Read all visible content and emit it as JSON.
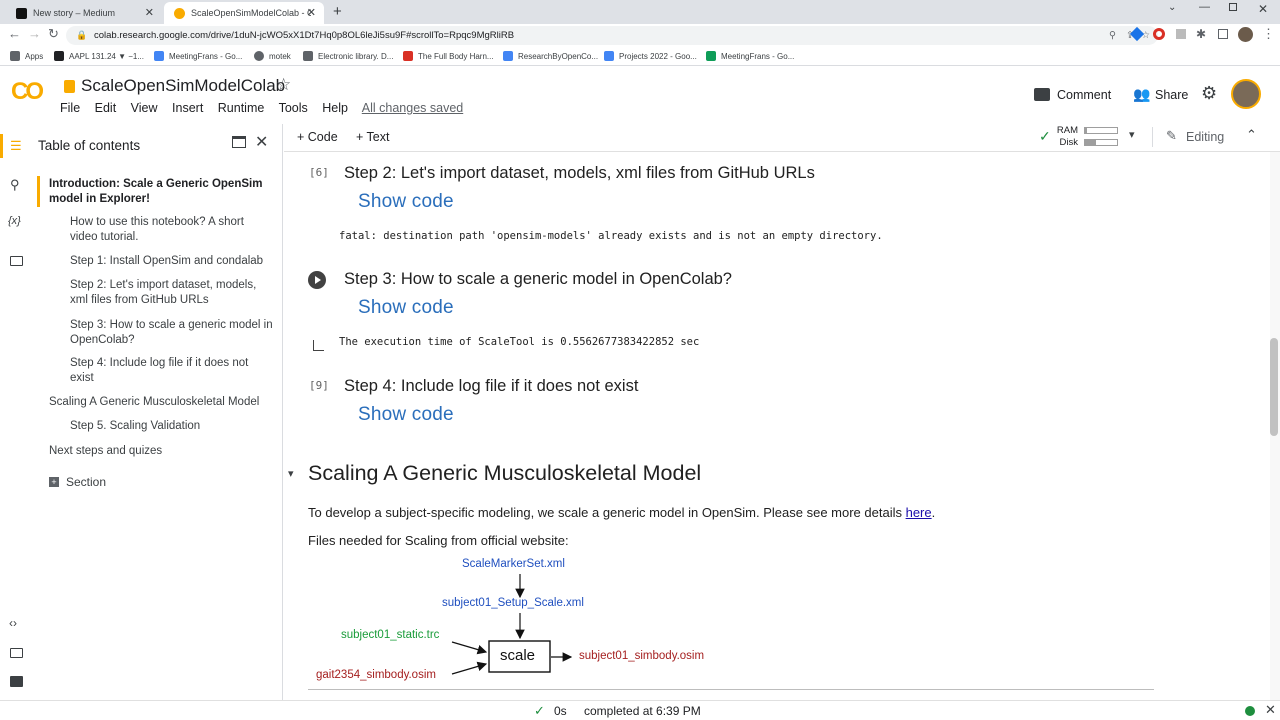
{
  "browser": {
    "tabs": [
      {
        "title": "New story – Medium",
        "active": false
      },
      {
        "title": "ScaleOpenSimModelColab - Colab",
        "active": true
      }
    ],
    "new_tab": "+",
    "url": "colab.research.google.com/drive/1duN-jcWO5xX1Dt7Hq0p8OL6leJi5su9F#scrollTo=Rpqc9MgRliRB",
    "bookmarks": [
      {
        "label": "Apps",
        "color": "#5f6368"
      },
      {
        "label": "AAPL 131.24 ▼ −1...",
        "color": "#202124"
      },
      {
        "label": "MeetingFrans - Go...",
        "color": "#4285f4"
      },
      {
        "label": "motek",
        "color": "#5f6368"
      },
      {
        "label": "Electronic library. D...",
        "color": "#5f6368"
      },
      {
        "label": "The Full Body Harn...",
        "color": "#d93025"
      },
      {
        "label": "ResearchByOpenCo...",
        "color": "#4285f4"
      },
      {
        "label": "Projects 2022 - Goo...",
        "color": "#4285f4"
      },
      {
        "label": "MeetingFrans - Go...",
        "color": "#0f9d58"
      }
    ]
  },
  "colab": {
    "logo": "CO",
    "notebook_title": "ScaleOpenSimModelColab",
    "menu": [
      "File",
      "Edit",
      "View",
      "Insert",
      "Runtime",
      "Tools",
      "Help"
    ],
    "save_status": "All changes saved",
    "comment_label": "Comment",
    "share_label": "Share",
    "add_code": "+ Code",
    "add_text": "+ Text",
    "ram_label": "RAM",
    "disk_label": "Disk",
    "editing_label": "Editing"
  },
  "toc": {
    "title": "Table of contents",
    "items": [
      {
        "text": "Introduction: Scale a Generic OpenSim model in Explorer!",
        "level": 1,
        "active": true
      },
      {
        "text": "How to use this notebook? A short video tutorial.",
        "level": 2
      },
      {
        "text": "Step 1: Install OpenSim and condalab",
        "level": 2
      },
      {
        "text": "Step 2: Let's import dataset, models, xml files from GitHub URLs",
        "level": 2
      },
      {
        "text": "Step 3: How to scale a generic model in OpenColab?",
        "level": 2
      },
      {
        "text": "Step 4: Include log file if it does not exist",
        "level": 2
      },
      {
        "text": "Scaling A Generic Musculoskeletal Model",
        "level": 1
      },
      {
        "text": "Step 5. Scaling Validation",
        "level": 2
      },
      {
        "text": "Next steps and quizes",
        "level": 1
      }
    ],
    "section_label": "Section"
  },
  "cells": [
    {
      "exec": "[6]",
      "heading": "Step 2: Let's import dataset, models, xml files from GitHub URLs",
      "show_code": "Show code",
      "output": "fatal: destination path 'opensim-models' already exists and is not an empty directory."
    },
    {
      "exec": "",
      "heading": "Step 3: How to scale a generic model in OpenColab?",
      "show_code": "Show code",
      "output": "The execution time of ScaleTool is 0.5562677383422852 sec"
    },
    {
      "exec": "[9]",
      "heading": "Step 4: Include log file if it does not exist",
      "show_code": "Show code",
      "output": ""
    }
  ],
  "section": {
    "title": "Scaling A Generic Musculoskeletal Model",
    "para1_prefix": "To develop a subject-specific modeling, we scale a generic model in OpenSim. Please see more details ",
    "para1_link": "here",
    "para1_suffix": ".",
    "para2": "Files needed for Scaling from official website:"
  },
  "diagram": {
    "marker_set": "ScaleMarkerSet.xml",
    "setup_scale": "subject01_Setup_Scale.xml",
    "static_trc": "subject01_static.trc",
    "generic_model": "gait2354_simbody.osim",
    "scale_box": "scale",
    "output_model": "subject01_simbody.osim",
    "colors": {
      "xml": "#1f4fbf",
      "trc": "#1a9c3a",
      "osim": "#a52020"
    }
  },
  "status": {
    "duration": "0s",
    "completed": "completed at 6:39 PM"
  }
}
